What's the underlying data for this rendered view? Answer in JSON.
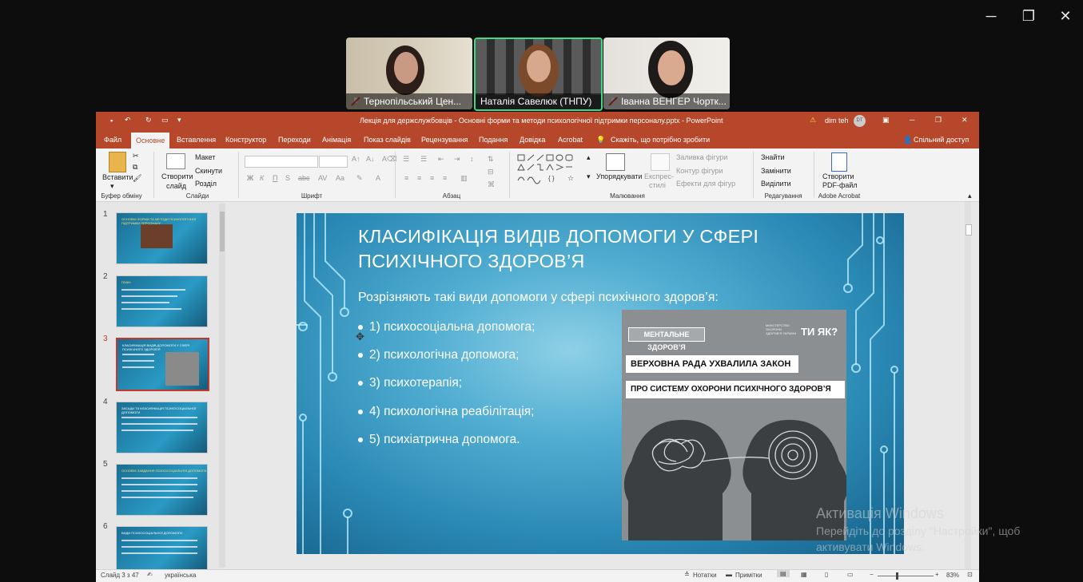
{
  "window_controls": {
    "minimize": "─",
    "restore": "❐",
    "close": "✕"
  },
  "participants": [
    {
      "name": "Тернопільський Цен..."
    },
    {
      "name": "Наталія Савелюк (ТНПУ)"
    },
    {
      "name": "Іванна ВЕНГЕР Чортк..."
    }
  ],
  "ppt": {
    "title": "Лекція для держслужбовців - Основні форми та методи психологічної підтримки персоналу.pptx  -  PowerPoint",
    "user_name": "dim teh",
    "user_initials": "DT",
    "tabs": [
      "Файл",
      "Основне",
      "Вставлення",
      "Конструктор",
      "Переходи",
      "Анімація",
      "Показ слайдів",
      "Рецензування",
      "Подання",
      "Довідка",
      "Acrobat"
    ],
    "tell_me": "Скажіть, що потрібно зробити",
    "share": "Спільний доступ",
    "ribbon": {
      "paste": "Вставити",
      "clipboard_group": "Буфер обміну",
      "new_slide_1": "Створити",
      "new_slide_2": "слайд",
      "layout": "Макет",
      "reset": "Скинути",
      "section": "Розділ",
      "slides_group": "Слайди",
      "font_group": "Шрифт",
      "bold": "Ж",
      "italic": "К",
      "underline": "П",
      "strike": "S",
      "paragraph_group": "Абзац",
      "arrange": "Упорядкувати",
      "quick_styles_1": "Експрес-",
      "quick_styles_2": "стилі",
      "shape_fill": "Заливка фігури",
      "shape_outline": "Контур фігури",
      "shape_effects": "Ефекти для фігур",
      "drawing_group": "Малювання",
      "find": "Знайти",
      "replace": "Замінити",
      "select": "Виділити",
      "editing_group": "Редагування",
      "pdf_1": "Створити",
      "pdf_2": "PDF-файл",
      "acrobat_group": "Adobe Acrobat"
    },
    "thumbnails": [
      {
        "num": "1",
        "title": "ОСНОВНІ ФОРМИ ТА МЕТОДИ ПСИХОЛОГІЧНОЇ ПІДТРИМКИ ПЕРСОНАЛУ"
      },
      {
        "num": "2",
        "title": "ПЛАН:"
      },
      {
        "num": "3",
        "title": "КЛАСИФІКАЦІЯ ВИДІВ ДОПОМОГИ У СФЕРІ ПСИХІЧНОГО ЗДОРОВ'Я"
      },
      {
        "num": "4",
        "title": "ЗАСАДИ ТА КЛАСИФІКАЦІЯ ПСИХОСОЦІАЛЬНОЇ ДОПОМОГИ"
      },
      {
        "num": "5",
        "title": "ОСНОВНІ ЗАВДАННЯ ПСИХОСОЦІАЛЬНОЇ ДОПОМОГИ"
      },
      {
        "num": "6",
        "title": "ВИДИ ПСИХОСОЦІАЛЬНОЇ ДОПОМОГИ"
      }
    ],
    "slide": {
      "title": "КЛАСИФІКАЦІЯ ВИДІВ ДОПОМОГИ У СФЕРІ ПСИХІЧНОГО ЗДОРОВ’Я",
      "subtitle": "Розрізняють такі види допомоги у сфері психічного здоров’я:",
      "bullets": [
        "1) психосоціальна допомога;",
        "2) психологічна допомога;",
        "3) психотерапія;",
        "4) психологічна реабілітація;",
        "5) психіатрична допомога."
      ],
      "image": {
        "tag": "МЕНТАЛЬНЕ ЗДОРОВ’Я",
        "ministry": "МІНІСТЕРСТВО ОХОРОНИ ЗДОРОВ’Я УКРАЇНИ",
        "brand": "ТИ ЯК?",
        "headline1": "ВЕРХОВНА РАДА УХВАЛИЛА ЗАКОН",
        "headline2": "ПРО СИСТЕМУ ОХОРОНИ ПСИХІЧНОГО ЗДОРОВ’Я"
      }
    },
    "status": {
      "slide_info": "Слайд 3 з 47",
      "language": "українська",
      "notes": "Нотатки",
      "comments": "Примітки",
      "zoom": "83%"
    }
  },
  "activation": {
    "title": "Активація Windows",
    "line1": "Перейдіть до розділу \"Настройки\", щоб",
    "line2": "активувати Windows."
  },
  "colors": {
    "ppt_accent": "#b7472a",
    "active_speaker": "#3ddc84"
  }
}
